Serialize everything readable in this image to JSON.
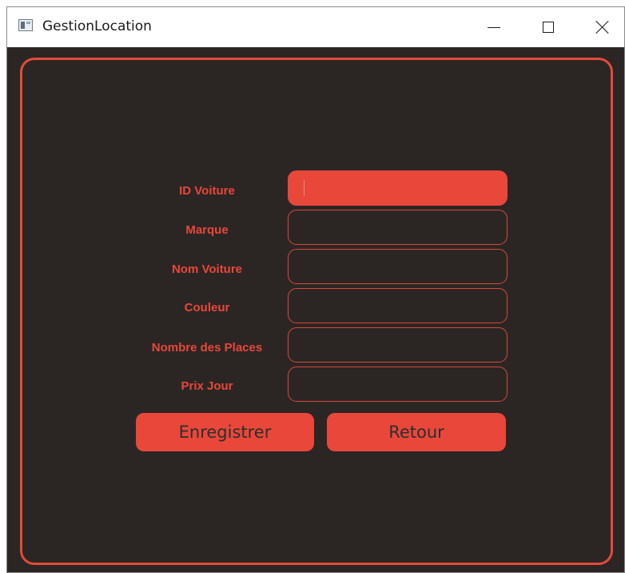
{
  "window": {
    "title": "GestionLocation"
  },
  "form": {
    "fields": [
      {
        "label": "ID Voiture",
        "value": "",
        "active": true
      },
      {
        "label": "Marque",
        "value": ""
      },
      {
        "label": "Nom Voiture",
        "value": ""
      },
      {
        "label": "Couleur",
        "value": ""
      },
      {
        "label": "Nombre des Places",
        "value": ""
      },
      {
        "label": "Prix Jour",
        "value": ""
      }
    ]
  },
  "buttons": {
    "save_label": "Enregistrer",
    "back_label": "Retour"
  },
  "colors": {
    "accent": "#e8473a",
    "background": "#2b2624",
    "button_text": "#2e2e2e"
  },
  "icons": {
    "app": "app-window-icon",
    "minimize": "minimize-icon",
    "maximize": "maximize-icon",
    "close": "close-icon"
  }
}
